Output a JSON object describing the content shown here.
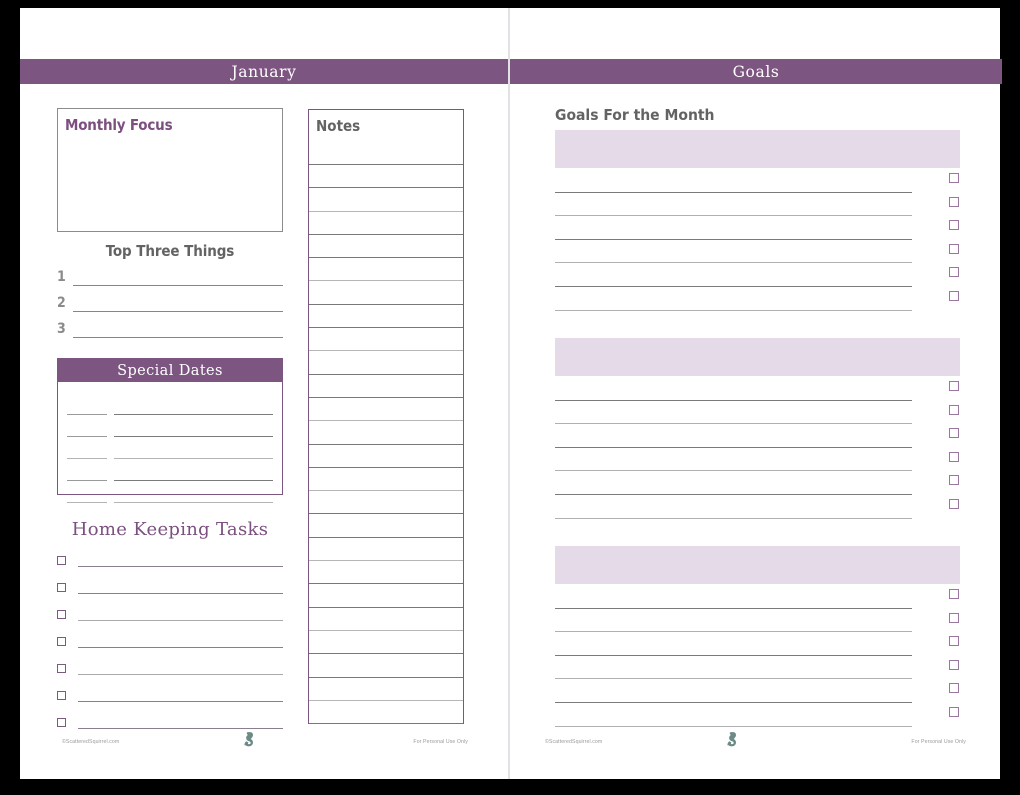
{
  "document": {
    "type": "monthly-planner-spread",
    "colors": {
      "band_purple": "#7c5580",
      "block_lavender": "#e5dae8",
      "accent_purple": "#7b4f7f",
      "rule_gray": "#7b7b7b",
      "rule_light": "#b0b0b0",
      "heading_gray": "#636363"
    }
  },
  "left_page": {
    "band_title": "January",
    "monthly_focus": {
      "title": "Monthly Focus",
      "lines": 0
    },
    "top_three": {
      "title": "Top Three Things",
      "numbers": [
        "1",
        "2",
        "3"
      ]
    },
    "special_dates": {
      "title": "Special Dates",
      "rows": 5
    },
    "home_keeping": {
      "title": "Home Keeping Tasks",
      "rows": 7
    },
    "notes": {
      "title": "Notes",
      "lines": 25
    },
    "footer": {
      "copyright": "©ScatteredSquirrel.com",
      "logo": "squirrel-logo",
      "usage": "For Personal Use Only"
    }
  },
  "right_page": {
    "band_title": "Goals",
    "section_heading": "Goals For the Month",
    "goal_groups": [
      {
        "label": "",
        "lines": 6,
        "checkboxes": 6
      },
      {
        "label": "",
        "lines": 6,
        "checkboxes": 6
      },
      {
        "label": "",
        "lines": 6,
        "checkboxes": 6
      }
    ],
    "footer": {
      "copyright": "©ScatteredSquirrel.com",
      "logo": "squirrel-logo",
      "usage": "For Personal Use Only"
    }
  }
}
